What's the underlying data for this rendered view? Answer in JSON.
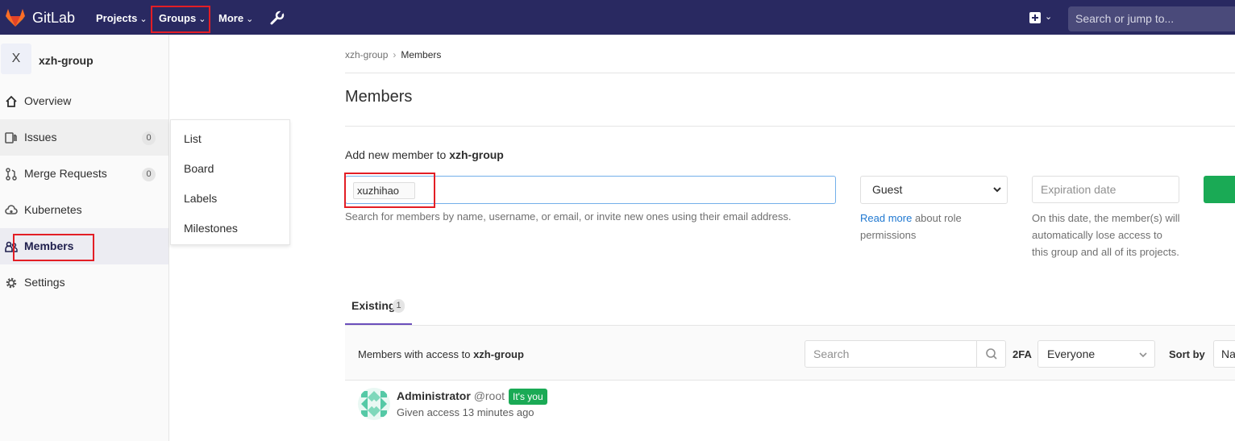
{
  "navbar": {
    "brand": "GitLab",
    "projects_label": "Projects",
    "groups_label": "Groups",
    "more_label": "More",
    "chevron": "⌄",
    "search_placeholder": "Search or jump to..."
  },
  "sidebar": {
    "group_initial": "X",
    "group_name": "xzh-group",
    "items": [
      {
        "label": "Overview",
        "icon": "home-icon"
      },
      {
        "label": "Issues",
        "icon": "issues-icon",
        "count": "0"
      },
      {
        "label": "Merge Requests",
        "icon": "merge-request-icon",
        "count": "0"
      },
      {
        "label": "Kubernetes",
        "icon": "cloud-icon"
      },
      {
        "label": "Members",
        "icon": "users-icon"
      },
      {
        "label": "Settings",
        "icon": "gear-icon"
      }
    ]
  },
  "flyout": {
    "items": [
      "List",
      "Board",
      "Labels",
      "Milestones"
    ]
  },
  "breadcrumb": {
    "group": "xzh-group",
    "separator": "›",
    "current": "Members"
  },
  "page": {
    "title": "Members"
  },
  "add_member": {
    "label_prefix": "Add new member to",
    "group": "xzh-group",
    "token": "xuzhihao",
    "help": "Search for members by name, username, or email, or invite new ones using their email address.",
    "role_value": "Guest",
    "role_help_link": "Read more",
    "role_help_rest": "about role permissions",
    "expiration_placeholder": "Expiration date",
    "expiration_help": "On this date, the member(s) will automatically lose access to this group and all of its projects."
  },
  "tabs": [
    {
      "label": "Existing",
      "count": "1"
    }
  ],
  "members_panel": {
    "title_prefix": "Members with access to",
    "group": "xzh-group",
    "search_placeholder": "Search",
    "twofa_label": "2FA",
    "twofa_value": "Everyone",
    "sort_label": "Sort by",
    "sort_value": "Na"
  },
  "members": [
    {
      "name": "Administrator",
      "handle": "@root",
      "badge": "It's you",
      "meta": "Given access 13 minutes ago"
    }
  ],
  "colors": {
    "navbar": "#292961",
    "highlight": "#e31e25",
    "success": "#1aaa55",
    "link": "#1f78d1",
    "active_tab": "#6b4fbb"
  }
}
